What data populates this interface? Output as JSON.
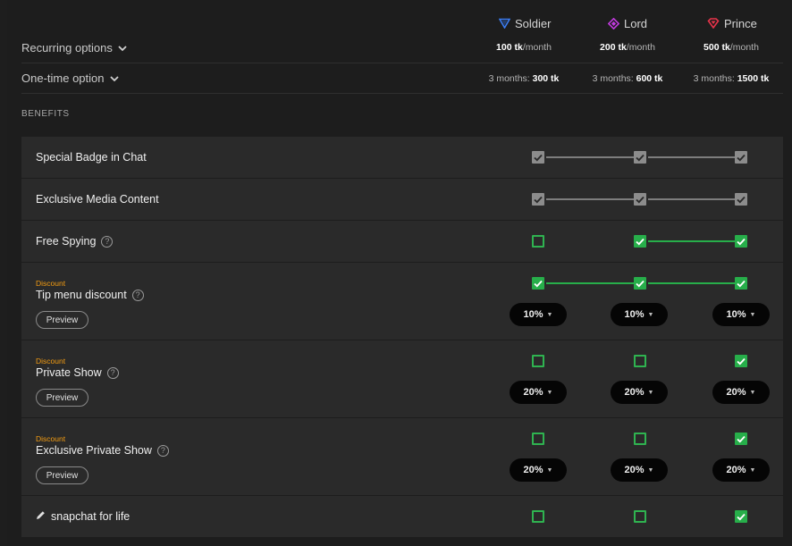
{
  "tiers": [
    {
      "name": "Soldier",
      "color": "#3a7bf0",
      "icon": "triangle-gem-icon",
      "monthly": "100 tk",
      "monthly_unit": "/month",
      "onetime_prefix": "3 months: ",
      "onetime": "300 tk"
    },
    {
      "name": "Lord",
      "color": "#c23adf",
      "icon": "diamond-gem-icon",
      "monthly": "200 tk",
      "monthly_unit": "/month",
      "onetime_prefix": "3 months: ",
      "onetime": "600 tk"
    },
    {
      "name": "Prince",
      "color": "#e8334a",
      "icon": "heart-gem-icon",
      "monthly": "500 tk",
      "monthly_unit": "/month",
      "onetime_prefix": "3 months: ",
      "onetime": "1500 tk"
    }
  ],
  "options": {
    "recurring_label": "Recurring options",
    "onetime_label": "One-time option"
  },
  "benefits_title": "BENEFITS",
  "colors": {
    "gray_check": "#8c8c8c",
    "green_check": "#27ae4a",
    "discount": "#f39c12"
  },
  "benefits": [
    {
      "title": "Special Badge in Chat",
      "help": false,
      "discount": "",
      "preview": "",
      "checks": [
        "gray",
        "gray",
        "gray"
      ],
      "pills": []
    },
    {
      "title": "Exclusive Media Content",
      "help": false,
      "discount": "",
      "preview": "",
      "checks": [
        "gray",
        "gray",
        "gray"
      ],
      "pills": []
    },
    {
      "title": "Free Spying",
      "help": true,
      "discount": "",
      "preview": "",
      "checks": [
        "empty",
        "green",
        "green"
      ],
      "pills": []
    },
    {
      "title": "Tip menu discount",
      "help": true,
      "discount": "Discount",
      "preview": "Preview",
      "checks": [
        "green",
        "green",
        "green"
      ],
      "pills": [
        "10%",
        "10%",
        "10%"
      ]
    },
    {
      "title": "Private Show",
      "help": true,
      "discount": "Discount",
      "preview": "Preview",
      "checks": [
        "empty",
        "empty",
        "green"
      ],
      "pills": [
        "20%",
        "20%",
        "20%"
      ]
    },
    {
      "title": "Exclusive Private Show",
      "help": true,
      "discount": "Discount",
      "preview": "Preview",
      "checks": [
        "empty",
        "empty",
        "green"
      ],
      "pills": [
        "20%",
        "20%",
        "20%"
      ]
    },
    {
      "title": "snapchat for life",
      "help": false,
      "discount": "",
      "preview": "",
      "checks": [
        "empty",
        "empty",
        "green"
      ],
      "pills": [],
      "pencil": true
    }
  ],
  "help_glyph": "?"
}
